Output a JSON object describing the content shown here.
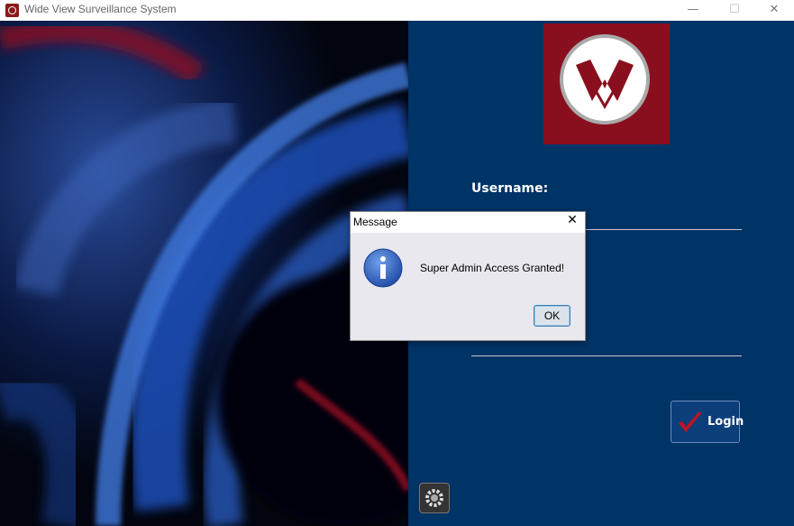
{
  "window": {
    "title": "Wide View Surveillance System",
    "minimize_glyph": "—",
    "maximize_glyph": "☐",
    "close_glyph": "✕"
  },
  "login": {
    "username_label": "Username:",
    "login_button": "Login"
  },
  "dialog": {
    "title": "Message",
    "close_glyph": "✕",
    "message": "Super Admin Access Granted!",
    "ok_label": "OK",
    "icon": "info-icon"
  },
  "colors": {
    "right_panel": "#003366",
    "logo_bg": "#8a0f1e",
    "info_blue": "#2a5fb3"
  },
  "icons": [
    "app-logo-icon",
    "w-logo-icon",
    "checkmark-icon",
    "gear-icon",
    "info-icon"
  ]
}
